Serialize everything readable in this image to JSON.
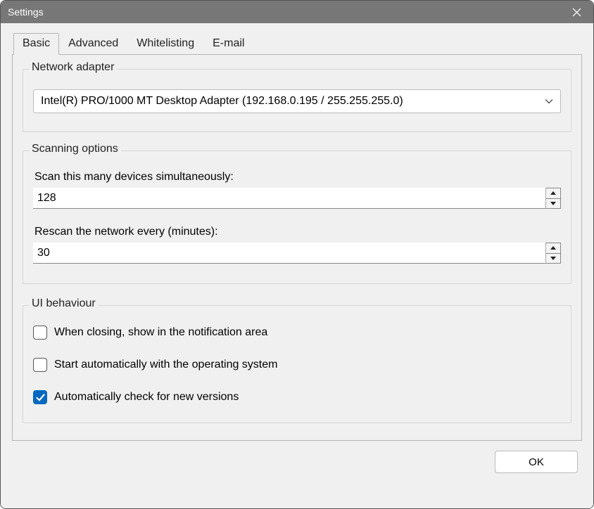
{
  "window": {
    "title": "Settings"
  },
  "tabs": [
    {
      "label": "Basic",
      "active": true
    },
    {
      "label": "Advanced",
      "active": false
    },
    {
      "label": "Whitelisting",
      "active": false
    },
    {
      "label": "E-mail",
      "active": false
    }
  ],
  "network_adapter": {
    "legend": "Network adapter",
    "selected": "Intel(R) PRO/1000 MT Desktop Adapter (192.168.0.195 / 255.255.255.0)"
  },
  "scanning": {
    "legend": "Scanning options",
    "simultaneous_label": "Scan this many devices simultaneously:",
    "simultaneous_value": "128",
    "rescan_label": "Rescan the network every (minutes):",
    "rescan_value": "30"
  },
  "ui_behaviour": {
    "legend": "UI behaviour",
    "tray_label": "When closing, show in the notification area",
    "tray_checked": false,
    "autostart_label": "Start automatically with the operating system",
    "autostart_checked": false,
    "update_label": "Automatically check for new versions",
    "update_checked": true
  },
  "buttons": {
    "ok": "OK"
  }
}
